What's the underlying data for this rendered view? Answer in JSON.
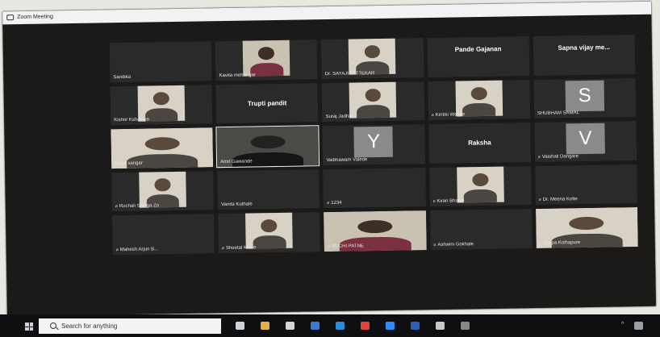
{
  "window": {
    "title": "Zoom Meeting"
  },
  "tiles": [
    {
      "name": "Sandika",
      "kind": "blank",
      "muted": false
    },
    {
      "name": "Kavita mehte gar",
      "kind": "photo",
      "style": "wall",
      "muted": false
    },
    {
      "name": "Dr. SAYAJI PATTEKAR",
      "kind": "photo",
      "style": "light",
      "muted": false
    },
    {
      "name": "",
      "center": "Pande Gajanan",
      "centerTop": true,
      "kind": "blank",
      "muted": false
    },
    {
      "name": "",
      "center": "Sapna vijay me...",
      "centerTop": true,
      "kind": "blank",
      "muted": false
    },
    {
      "name": "Kishor Kshatriya",
      "kind": "photo",
      "style": "light",
      "muted": false
    },
    {
      "name": "",
      "center": "Trupti pandit",
      "kind": "blank",
      "muted": false
    },
    {
      "name": "Suraj Jadhav",
      "kind": "photo",
      "style": "light",
      "muted": false
    },
    {
      "name": "Kiritiki Walgre",
      "kind": "photo",
      "style": "light",
      "muted": true
    },
    {
      "name": "SHUBHAM SAMAL",
      "kind": "letter",
      "letter": "S",
      "muted": false
    },
    {
      "name": "Lohul sangar",
      "kind": "photofull",
      "style": "light",
      "muted": false
    },
    {
      "name": "Amit Gawande",
      "kind": "photofull",
      "style": "dark",
      "muted": false,
      "active": true
    },
    {
      "name": "Vaibhawam Valede",
      "kind": "letter",
      "letter": "Y",
      "muted": false
    },
    {
      "name": "",
      "center": "Raksha",
      "kind": "blank",
      "muted": true
    },
    {
      "name": "Vaishali Dangare",
      "kind": "letter",
      "letter": "V",
      "muted": true
    },
    {
      "name": "Ruchali Shinga Zo",
      "kind": "photo",
      "style": "light",
      "muted": true
    },
    {
      "name": "Vanita Kuthale",
      "kind": "blank",
      "muted": false
    },
    {
      "name": "1234",
      "kind": "blank",
      "muted": true
    },
    {
      "name": "Kiran Bhalse",
      "kind": "photo",
      "style": "light",
      "muted": true
    },
    {
      "name": "Dr. Meena Kolte",
      "kind": "blank",
      "muted": true
    },
    {
      "name": "Mahesh Arjun B...",
      "kind": "blank",
      "muted": true
    },
    {
      "name": "Sheetal Khale",
      "kind": "photo",
      "style": "light",
      "muted": true
    },
    {
      "name": "RUCHI PATNE",
      "kind": "photofull",
      "style": "wall",
      "muted": true
    },
    {
      "name": "Ashwini Gokhale",
      "kind": "blank",
      "muted": true
    },
    {
      "name": "Shilpa Kolhapure",
      "kind": "photofull",
      "style": "light",
      "muted": true
    }
  ],
  "taskbar": {
    "search_placeholder": "Search for anything",
    "mute_symbol": "🎤̸",
    "apps": [
      "task-view-icon",
      "file-explorer-icon",
      "store-icon",
      "mail-icon",
      "edge-icon",
      "chrome-icon",
      "zoom-icon",
      "word-icon",
      "files-icon",
      "app-icon"
    ],
    "tray_text": "^ ☐"
  }
}
